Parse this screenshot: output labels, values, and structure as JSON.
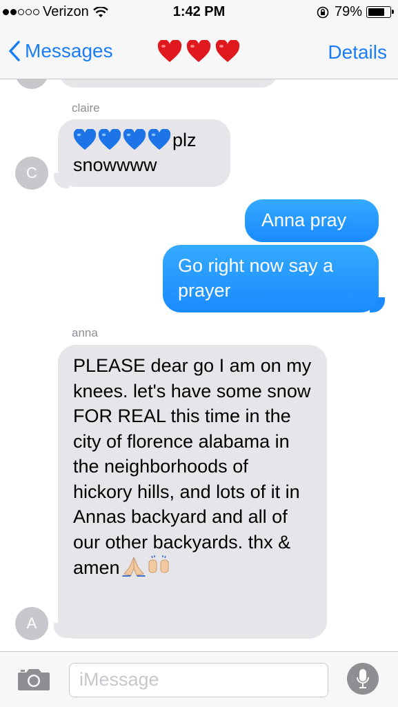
{
  "status": {
    "carrier": "Verizon",
    "time": "1:42 PM",
    "battery": "79%",
    "signal_bars_filled": 2,
    "signal_bars_total": 5,
    "battery_level": 0.79
  },
  "nav": {
    "back_label": "Messages",
    "title_emoji": [
      "red-heart",
      "red-heart",
      "red-heart"
    ],
    "details_label": "Details"
  },
  "messages": [
    {
      "sender": "claire",
      "avatar": "C",
      "direction": "incoming",
      "emoji_prefix": [
        "blue-heart",
        "blue-heart",
        "blue-heart",
        "blue-heart"
      ],
      "text_line1": "plz",
      "text_line2": "snowwww"
    },
    {
      "direction": "outgoing",
      "text": "Anna pray"
    },
    {
      "direction": "outgoing",
      "text": "Go right now say a prayer"
    },
    {
      "sender": "anna",
      "avatar": "A",
      "direction": "incoming",
      "text": "PLEASE dear go I am on my knees. let's have some snow FOR REAL this time in the city of florence alabama in the neighborhoods of hickory hills, and lots of it in Annas backyard and all of our other backyards. thx & amen",
      "emoji_suffix": [
        "folded-hands",
        "raised-hands"
      ]
    }
  ],
  "input": {
    "placeholder": "iMessage"
  },
  "colors": {
    "accent": "#1a7df5",
    "outgoing_bubble": "#1a8aff",
    "incoming_bubble": "#e5e5ea"
  }
}
